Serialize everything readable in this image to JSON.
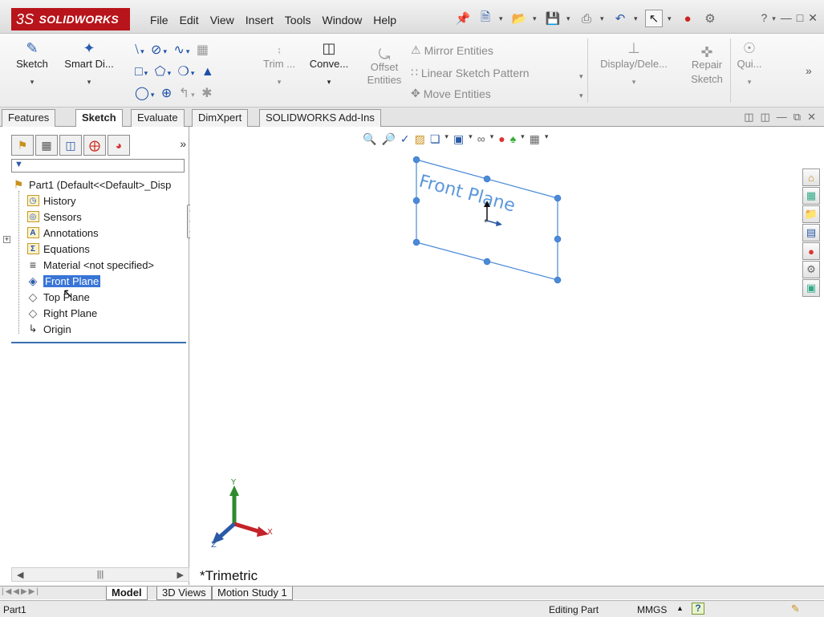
{
  "titlebar": {
    "logo_prefix": "3S",
    "logo_text": "SOLIDWORKS",
    "menus": [
      "File",
      "Edit",
      "View",
      "Insert",
      "Tools",
      "Window",
      "Help"
    ]
  },
  "ribbon": {
    "sketch": "Sketch",
    "smart_dim": "Smart Di...",
    "trim": "Trim ...",
    "convert": "Conve...",
    "offset_line1": "Offset",
    "offset_line2": "Entities",
    "mirror": "Mirror Entities",
    "linear_pattern": "Linear Sketch Pattern",
    "move": "Move Entities",
    "display_delete": "Display/Dele...",
    "repair_line1": "Repair",
    "repair_line2": "Sketch",
    "quick": "Qui..."
  },
  "tabs": [
    "Features",
    "Sketch",
    "Evaluate",
    "DimXpert",
    "SOLIDWORKS Add-Ins"
  ],
  "tree": {
    "root": "Part1  (Default<<Default>_Disp",
    "history": "History",
    "sensors": "Sensors",
    "annotations": "Annotations",
    "equations": "Equations",
    "material": "Material <not specified>",
    "front_plane": "Front Plane",
    "top_plane": "Top Plane",
    "right_plane": "Right Plane",
    "origin": "Origin"
  },
  "graphics": {
    "plane_label": "Front Plane",
    "axis_x": "X",
    "axis_y": "Y",
    "axis_z": "Z",
    "view_orientation": "*Trimetric"
  },
  "model_tabs": [
    "Model",
    "3D Views",
    "Motion Study 1"
  ],
  "status": {
    "left": "Part1",
    "mode": "Editing Part",
    "units": "MMGS",
    "help": "?"
  },
  "colors": {
    "brand_red": "#b8141b",
    "selection": "#3875d7",
    "plane_blue": "#4a8ad8"
  }
}
